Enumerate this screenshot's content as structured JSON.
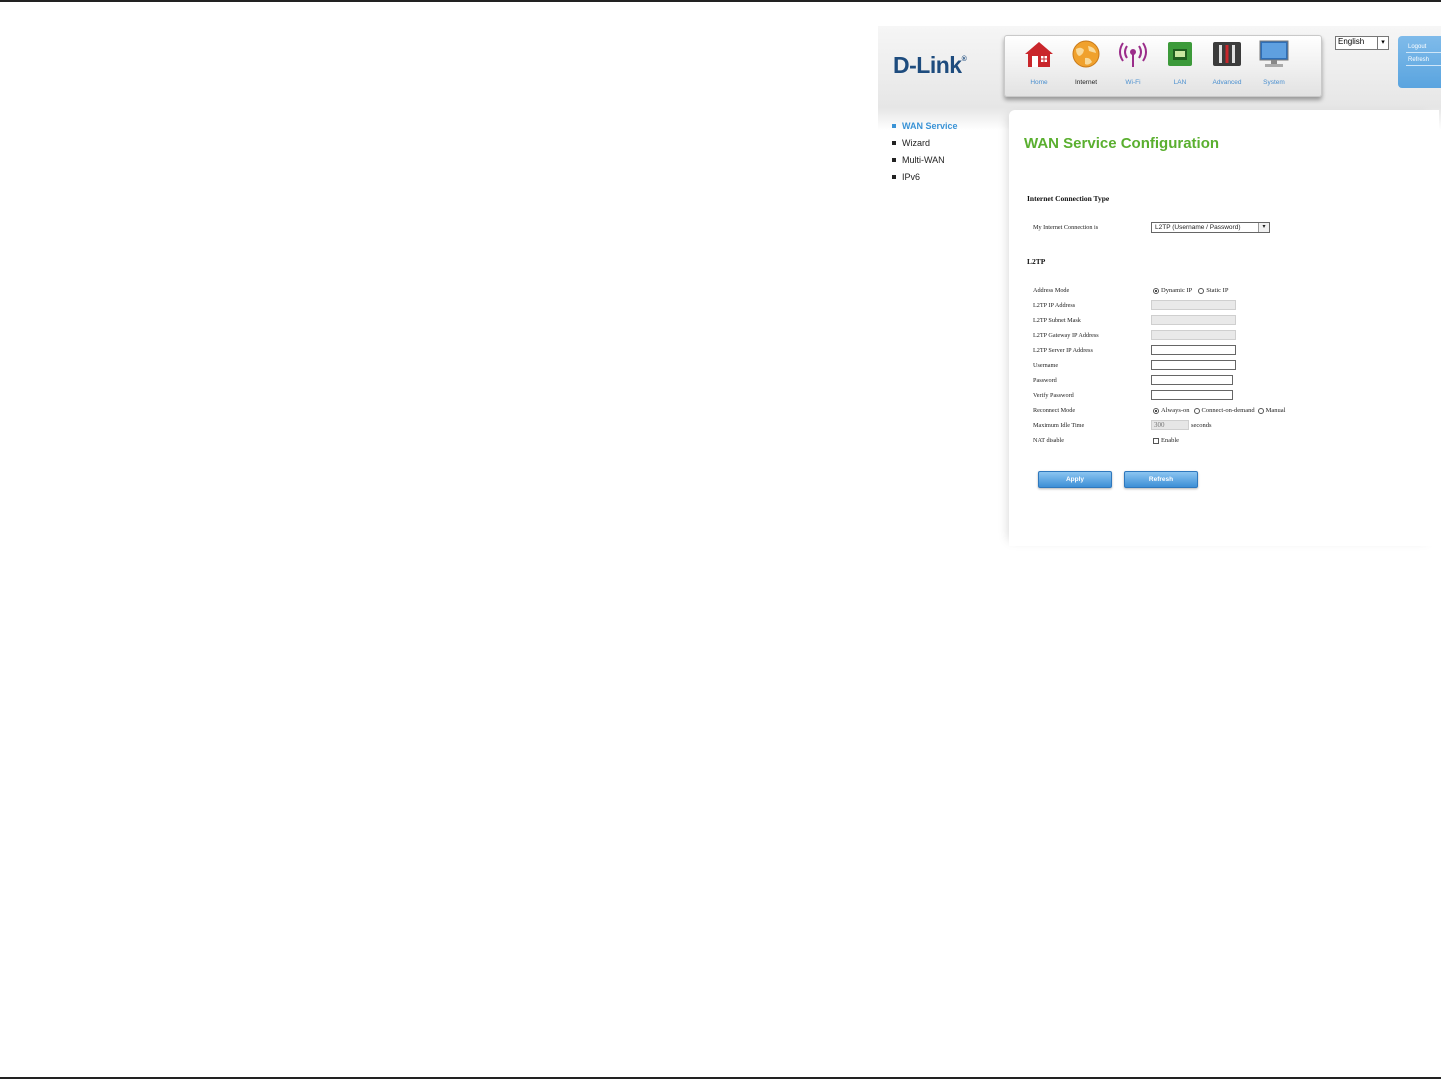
{
  "brand": {
    "logo": "D-Link",
    "reg": "®"
  },
  "nav": {
    "items": [
      {
        "label": "Home",
        "icon": "home-icon"
      },
      {
        "label": "Internet",
        "icon": "globe-icon",
        "active": true
      },
      {
        "label": "Wi-Fi",
        "icon": "wifi-icon"
      },
      {
        "label": "LAN",
        "icon": "lan-icon"
      },
      {
        "label": "Advanced",
        "icon": "tools-icon"
      },
      {
        "label": "System",
        "icon": "monitor-icon"
      }
    ]
  },
  "language": {
    "selected": "English"
  },
  "account": {
    "logout": "Logout",
    "refresh": "Refresh"
  },
  "sidebar": {
    "items": [
      {
        "label": "WAN Service",
        "active": true
      },
      {
        "label": "Wizard"
      },
      {
        "label": "Multi-WAN"
      },
      {
        "label": "IPv6"
      }
    ]
  },
  "page": {
    "title": "WAN Service Configuration",
    "section_connection": "Internet Connection Type",
    "connection_label": "My Internet Connection is",
    "connection_value": "L2TP (Username / Password)",
    "section_l2tp": "L2TP",
    "fields": {
      "address_mode": "Address Mode",
      "dynamic_ip": "Dynamic IP",
      "static_ip": "Static IP",
      "ip_address": "L2TP IP Address",
      "subnet_mask": "L2TP Subnet Mask",
      "gateway": "L2TP Gateway IP Address",
      "server_ip": "L2TP Server IP Address",
      "username": "Username",
      "password": "Password",
      "verify_password": "Verify Password",
      "reconnect_mode": "Reconnect Mode",
      "always_on": "Always-on",
      "connect_on_demand": "Connect-on-demand",
      "manual": "Manual",
      "max_idle": "Maximum Idle Time",
      "max_idle_value": "300",
      "seconds": "seconds",
      "nat_disable": "NAT disable",
      "enable": "Enable"
    },
    "apply_label": "Apply",
    "refresh_label": "Refresh"
  },
  "colors": {
    "accent_green": "#5aaf2f",
    "accent_blue": "#3a93d6",
    "brand_blue": "#1e4c7e"
  }
}
